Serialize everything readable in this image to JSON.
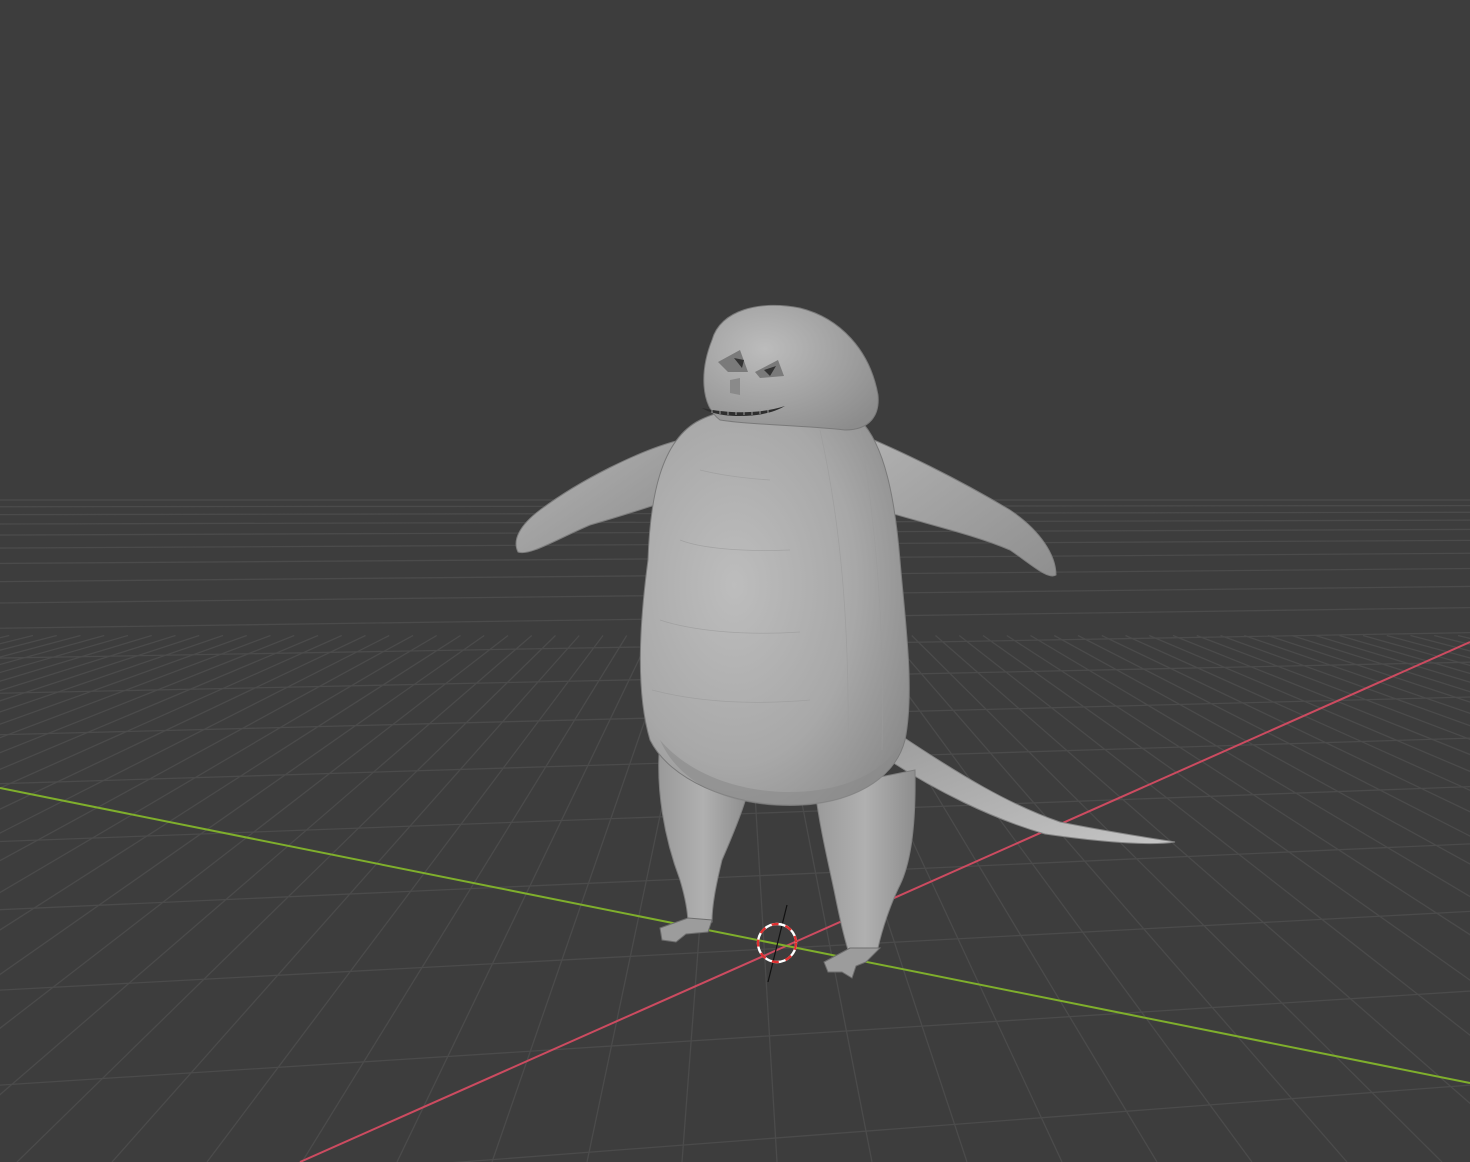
{
  "viewport": {
    "shading": "solid",
    "background_color": "#3d3d3d",
    "grid_color": "#4a4a4a",
    "x_axis_color": "#d2455c",
    "y_axis_color": "#84b62a",
    "model_color": "#a9a9a9",
    "object": "character-mesh",
    "cursor": "3d-cursor-icon"
  }
}
